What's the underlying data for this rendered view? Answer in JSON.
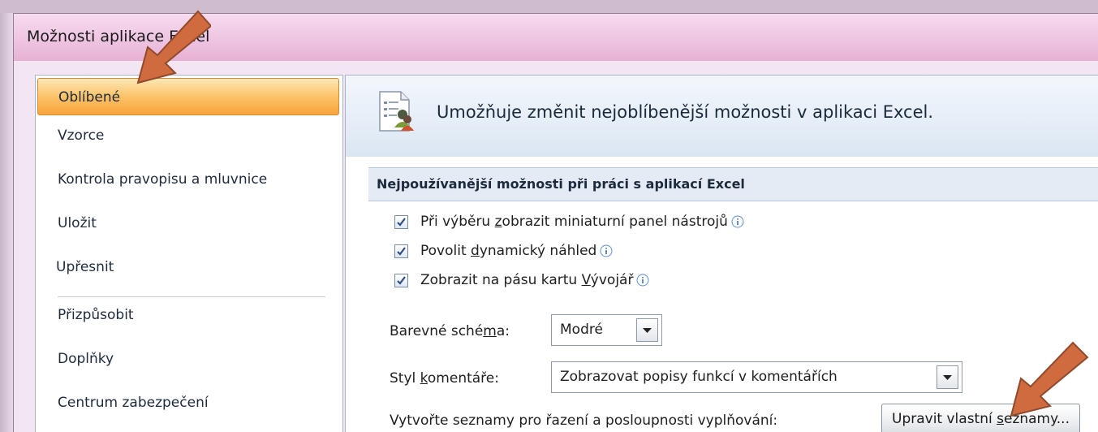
{
  "window": {
    "title": "Možnosti aplikace Excel"
  },
  "nav": {
    "items": [
      {
        "label": "Oblíbené",
        "selected": true
      },
      {
        "label": "Vzorce"
      },
      {
        "label": "Kontrola pravopisu a mluvnice"
      },
      {
        "label": "Uložit"
      },
      {
        "label": "Upřesnit"
      },
      {
        "label": "Přizpůsobit"
      },
      {
        "label": "Doplňky"
      },
      {
        "label": "Centrum zabezpečení"
      }
    ]
  },
  "content": {
    "header": "Umožňuje změnit nejoblíbenější možnosti v aplikaci Excel.",
    "section_title": "Nejpoužívanější možnosti při práci s aplikací Excel",
    "checkboxes": [
      {
        "pre": "Při výběru ",
        "ul": "z",
        "post": "obrazit miniaturní panel nástrojů",
        "checked": true
      },
      {
        "pre": "Povolit ",
        "ul": "d",
        "post": "ynamický náhled",
        "checked": true
      },
      {
        "pre": "Zobrazit na pásu kartu ",
        "ul": "V",
        "post": "ývojář",
        "checked": true
      }
    ],
    "color_scheme": {
      "label_pre": "Barevné sché",
      "label_ul": "m",
      "label_post": "a:",
      "value": "Modré"
    },
    "comment_style": {
      "label_pre": "Styl ",
      "label_ul": "k",
      "label_post": "omentáře:",
      "value": "Zobrazovat popisy funkcí v komentářích"
    },
    "lists": {
      "label": "Vytvořte seznamy pro řazení a posloupnosti vyplňování:",
      "button_pre": "Upravit vlastní ",
      "button_ul": "s",
      "button_post": "eznamy..."
    }
  },
  "colors": {
    "arrow": "#d06a3f",
    "selected_gradient_top": "#fde7b4",
    "selected_gradient_bottom": "#f8a33a",
    "title_bar": "#efc7e3"
  }
}
